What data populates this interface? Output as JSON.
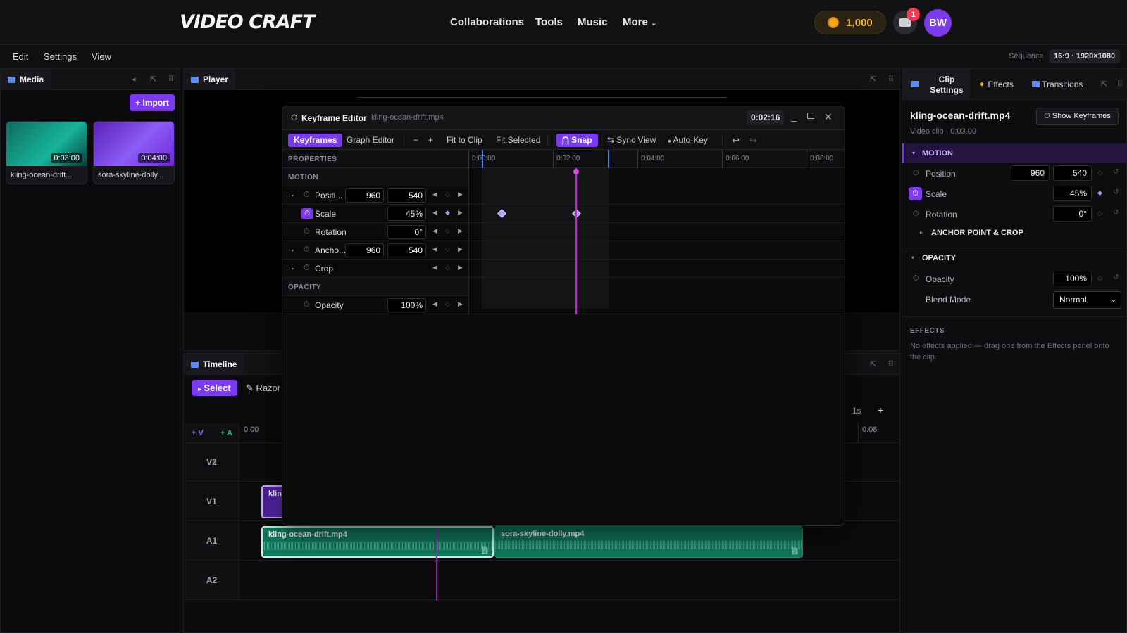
{
  "app": {
    "logo": "VIDEO CRAFT",
    "nav": [
      "Collaborations",
      "Tools",
      "Music",
      "More"
    ],
    "more_chevron": "chevron-down-icon",
    "coins": "1,000",
    "notifications": "1",
    "avatar": "BW",
    "accent": "#7c3aed"
  },
  "menubar": {
    "items": [
      "Edit",
      "Settings",
      "View"
    ],
    "sequence_label": "Sequence",
    "sequence_value": "16:9 · 1920×1080"
  },
  "media": {
    "tab": "Media",
    "import_label": "+ Import",
    "items": [
      {
        "name": "kling-ocean-drift.mp4",
        "duration": "0:03:00",
        "name_short": "kling-ocean-drift..."
      },
      {
        "name": "sora-skyline-dolly.mp4",
        "duration": "0:04:00",
        "name_short": "sora-skyline-dolly..."
      }
    ]
  },
  "player": {
    "tab": "Player"
  },
  "timeline": {
    "tab": "Timeline",
    "select": "Select",
    "razor": "Razor",
    "zoom": "1s",
    "add_v": "+ V",
    "add_a": "+ A",
    "ruler": [
      "0:00",
      "0:08"
    ],
    "tracks": [
      "V2",
      "V1",
      "A1",
      "A2"
    ],
    "clips": {
      "v1": "klin",
      "a1_1": "kling-ocean-drift.mp4",
      "a1_2": "sora-skyline-dolly.mp4"
    }
  },
  "keyframe_editor": {
    "title": "Keyframe Editor",
    "file": "kling-ocean-drift.mp4",
    "timecode": "0:02:16",
    "toolbar": {
      "keyframes": "Keyframes",
      "graph": "Graph Editor",
      "minus": "−",
      "plus": "+",
      "fit_clip": "Fit to Clip",
      "fit_selected": "Fit Selected",
      "snap": "Snap",
      "sync": "Sync View",
      "autokey": "Auto-Key"
    },
    "ruler": [
      "0:00:00",
      "0:02:00",
      "0:04:00",
      "0:06:00",
      "0:08:00"
    ],
    "properties_header": "PROPERTIES",
    "sections": {
      "motion": "MOTION",
      "opacity": "OPACITY"
    },
    "rows": [
      {
        "label": "Positi...",
        "v1": "960",
        "v2": "540"
      },
      {
        "label": "Scale",
        "v2": "45%"
      },
      {
        "label": "Rotation",
        "v2": "0°"
      },
      {
        "label": "Ancho...",
        "v1": "960",
        "v2": "540"
      },
      {
        "label": "Crop"
      },
      {
        "label": "Opacity",
        "v2": "100%"
      }
    ]
  },
  "clip_settings": {
    "tabs": [
      "Clip Settings",
      "Effects",
      "Transitions"
    ],
    "clip_name": "kling-ocean-drift.mp4",
    "show_keyframes": "Show Keyframes",
    "meta": "Video clip · 0:03.00",
    "motion": "MOTION",
    "position": {
      "label": "Position",
      "x": "960",
      "y": "540"
    },
    "scale": {
      "label": "Scale",
      "value": "45%"
    },
    "rotation": {
      "label": "Rotation",
      "value": "0°"
    },
    "anchor": "ANCHOR POINT & CROP",
    "opacity_sect": "OPACITY",
    "opacity": {
      "label": "Opacity",
      "value": "100%"
    },
    "blend": {
      "label": "Blend Mode",
      "value": "Normal"
    },
    "effects_header": "EFFECTS",
    "effects_empty": "No effects applied — drag one from the Effects panel onto the clip."
  }
}
